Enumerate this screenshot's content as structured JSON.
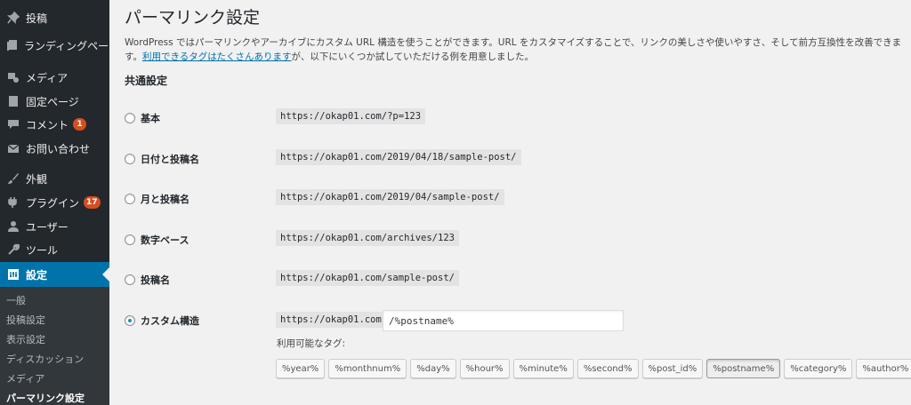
{
  "sidebar": {
    "items": [
      {
        "label": "投稿",
        "icon": "pin-icon"
      },
      {
        "label": "ランディングページ",
        "icon": "pages-icon"
      },
      {
        "label": "メディア",
        "icon": "media-icon"
      },
      {
        "label": "固定ページ",
        "icon": "page-icon"
      },
      {
        "label": "コメント",
        "icon": "comment-icon",
        "badge": "1"
      },
      {
        "label": "お問い合わせ",
        "icon": "mail-icon"
      },
      {
        "label": "外観",
        "icon": "brush-icon"
      },
      {
        "label": "プラグイン",
        "icon": "plugin-icon",
        "badge": "17"
      },
      {
        "label": "ユーザー",
        "icon": "user-icon"
      },
      {
        "label": "ツール",
        "icon": "wrench-icon"
      },
      {
        "label": "設定",
        "icon": "settings-icon",
        "active": true
      }
    ],
    "submenu": [
      "一般",
      "投稿設定",
      "表示設定",
      "ディスカッション",
      "メディア",
      "パーマリンク設定"
    ]
  },
  "main": {
    "title": "パーマリンク設定",
    "intro_text": "WordPress ではパーマリンクやアーカイブにカスタム URL 構造を使うことができます。URL をカスタマイズすることで、リンクの美しさや使いやすさ、そして前方互換性を改善できます。",
    "intro_link": "利用できるタグはたくさんあります",
    "intro_tail": "が、以下にいくつか試していただける例を用意しました。",
    "section_title": "共通設定",
    "options": [
      {
        "label": "基本",
        "url": "https://okap01.com/?p=123",
        "checked": false
      },
      {
        "label": "日付と投稿名",
        "url": "https://okap01.com/2019/04/18/sample-post/",
        "checked": false
      },
      {
        "label": "月と投稿名",
        "url": "https://okap01.com/2019/04/sample-post/",
        "checked": false
      },
      {
        "label": "数字ベース",
        "url": "https://okap01.com/archives/123",
        "checked": false
      },
      {
        "label": "投稿名",
        "url": "https://okap01.com/sample-post/",
        "checked": false
      },
      {
        "label": "カスタム構造",
        "url": "https://okap01.com",
        "checked": true
      }
    ],
    "custom_structure_value": "/%postname%",
    "tags_label": "利用可能なタグ:",
    "tags": [
      "%year%",
      "%monthnum%",
      "%day%",
      "%hour%",
      "%minute%",
      "%second%",
      "%post_id%",
      "%postname%",
      "%category%",
      "%author%"
    ],
    "active_tag": "%postname%"
  },
  "colors": {
    "sidebar_bg": "#23282d",
    "submenu_bg": "#32373c",
    "active_blue": "#0073aa",
    "badge": "#d54e21",
    "link": "#0073aa"
  }
}
